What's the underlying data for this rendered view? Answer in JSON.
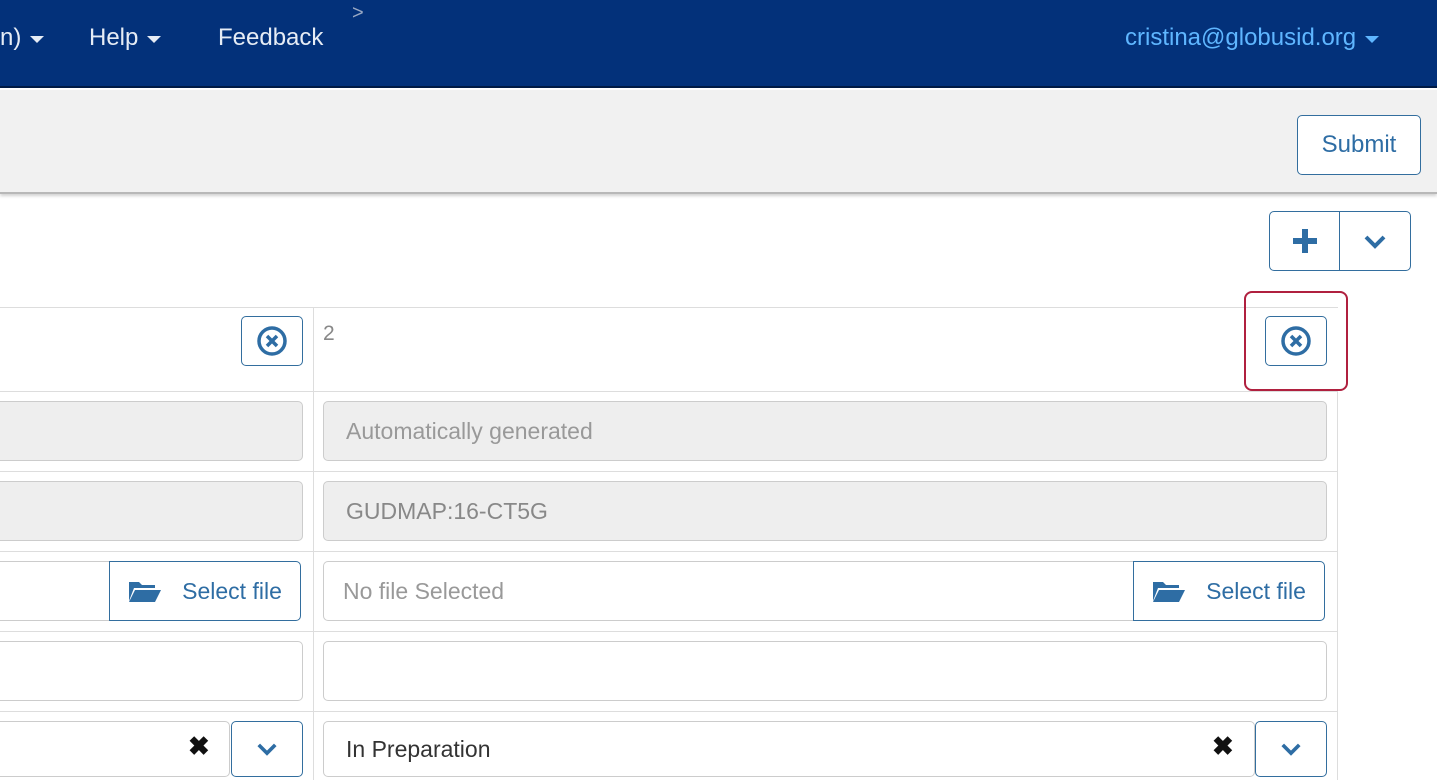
{
  "navbar": {
    "truncated_label": "n)",
    "help_label": "Help",
    "feedback_label": "Feedback",
    "breadcrumb_arrow": ">",
    "user_label": "cristina@globusid.org"
  },
  "actionbar": {
    "submit_label": "Submit"
  },
  "toolbar": {
    "add_icon": "plus-icon",
    "more_icon": "chevron-down-icon"
  },
  "record": {
    "number": "2",
    "rid_placeholder": "Automatically generated",
    "id_value": "GUDMAP:16-CT5G",
    "file_placeholder": "No file Selected",
    "select_file_label": "Select file",
    "left_select_file_label": "Select file",
    "text_value": "",
    "status_value": "In Preparation"
  },
  "colors": {
    "navbar": "#03317a",
    "accent": "#2e6da4",
    "highlight": "#b0203f"
  }
}
